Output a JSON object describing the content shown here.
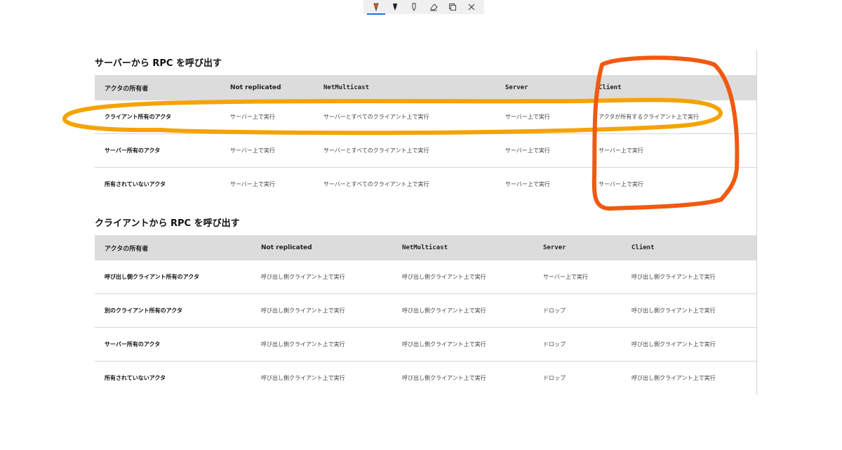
{
  "toolbar": {
    "tools": [
      "pen-icon",
      "highlighter-icon",
      "pencil-icon",
      "eraser-icon",
      "copy-icon",
      "close-icon"
    ],
    "active_tool": "pen-icon",
    "active_color": "#e8601c"
  },
  "server_section": {
    "title": "サーバーから RPC を呼び出す",
    "headers": [
      "アクタの所有者",
      "Not replicated",
      "NetMulticast",
      "Server",
      "Client"
    ],
    "rows": [
      [
        "クライアント所有のアクタ",
        "サーバー上で実行",
        "サーバーとすべてのクライアント上で実行",
        "サーバー上で実行",
        "アクタが所有するクライアント上で実行"
      ],
      [
        "サーバー所有のアクタ",
        "サーバー上で実行",
        "サーバーとすべてのクライアント上で実行",
        "サーバー上で実行",
        "サーバー上で実行"
      ],
      [
        "所有されていないアクタ",
        "サーバー上で実行",
        "サーバーとすべてのクライアント上で実行",
        "サーバー上で実行",
        "サーバー上で実行"
      ]
    ]
  },
  "client_section": {
    "title": "クライアントから RPC を呼び出す",
    "headers": [
      "アクタの所有者",
      "Not replicated",
      "NetMulticast",
      "Server",
      "Client"
    ],
    "rows": [
      [
        "呼び出し側クライアント所有のアクタ",
        "呼び出し側クライアント上で実行",
        "呼び出し側クライアント上で実行",
        "サーバー上で実行",
        "呼び出し側クライアント上で実行"
      ],
      [
        "別のクライアント所有のアクタ",
        "呼び出し側クライアント上で実行",
        "呼び出し側クライアント上で実行",
        "ドロップ",
        "呼び出し側クライアント上で実行"
      ],
      [
        "サーバー所有のアクタ",
        "呼び出し側クライアント上で実行",
        "呼び出し側クライアント上で実行",
        "ドロップ",
        "呼び出し側クライアント上で実行"
      ],
      [
        "所有されていないアクタ",
        "呼び出し側クライアント上で実行",
        "呼び出し側クライアント上で実行",
        "ドロップ",
        "呼び出し側クライアント上で実行"
      ]
    ]
  },
  "annotations": {
    "row_highlight_color": "#f5a300",
    "column_highlight_color": "#f05a10"
  }
}
